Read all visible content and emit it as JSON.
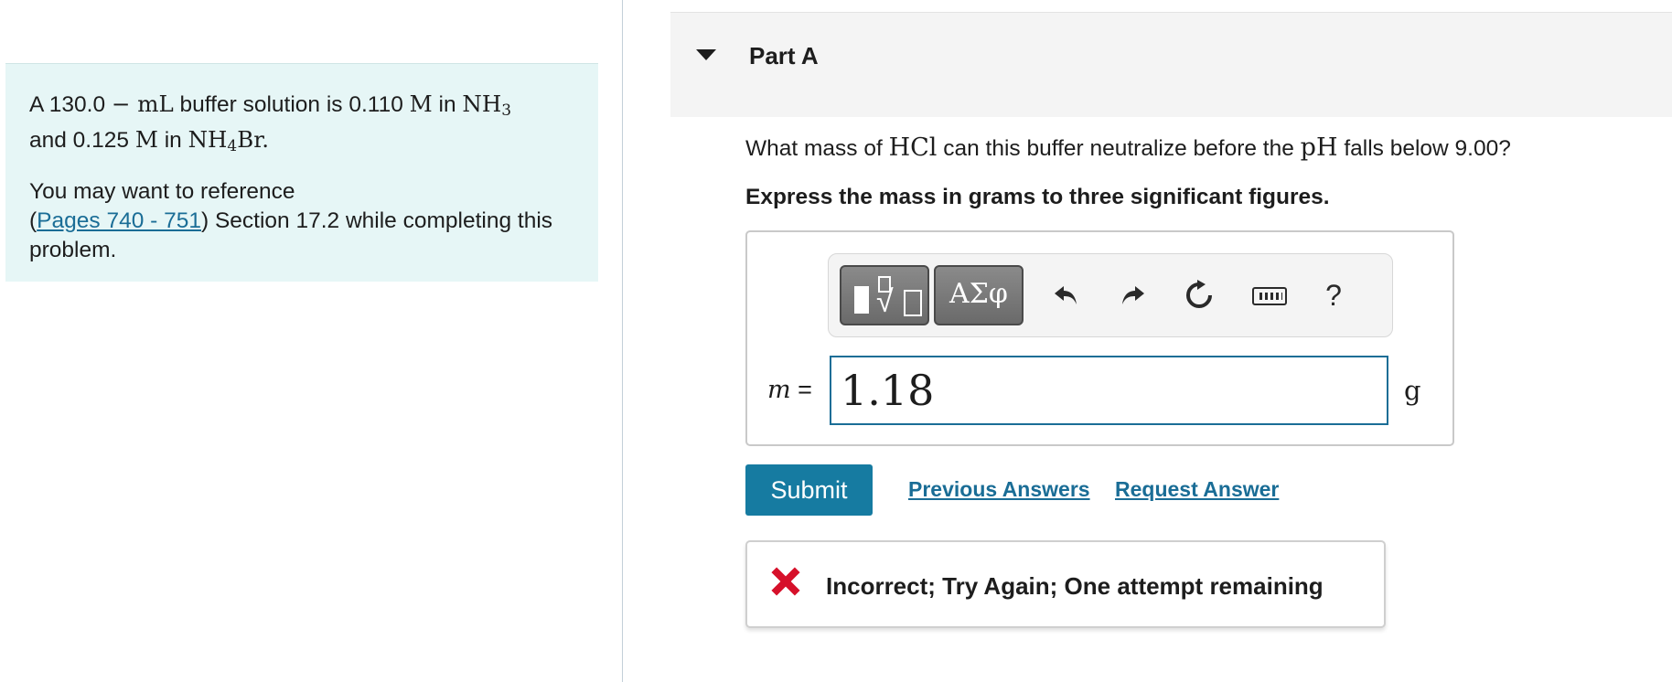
{
  "intro": {
    "p1": {
      "t1": "A 130.0 ",
      "m1": "− mL",
      "t2": " buffer solution is 0.110 ",
      "m2": "M",
      "t3": " in ",
      "m3_main": "NH",
      "m3_sub": "3",
      "t4": " and 0.125 ",
      "m4": "M",
      "t5": " in ",
      "m5_main": "NH",
      "m5_sub": "4",
      "m5_tail": "Br",
      "t6": "."
    },
    "ref_text_1": "You may want to reference",
    "ref_link": "Pages 740 - 751",
    "ref_text_2": ") Section 17.2 while completing this problem."
  },
  "part": {
    "title": "Part A"
  },
  "question": {
    "t1": "What mass of ",
    "m1": "HCl",
    "t2": " can this buffer neutralize before the ",
    "m2": "pH",
    "t3": " falls below 9.00?"
  },
  "instruction": "Express the mass in grams to three significant figures.",
  "toolbar": {
    "symbols_label": "ΑΣφ",
    "help_label": "?",
    "icons": [
      "templates-icon",
      "greek-symbols-icon",
      "undo-icon",
      "redo-icon",
      "reset-icon",
      "keyboard-icon",
      "help-icon"
    ]
  },
  "answer": {
    "variable": "m",
    "equals": " =",
    "value": "1.18",
    "unit": "g"
  },
  "actions": {
    "submit_label": "Submit",
    "previous_answers_label": "Previous Answers",
    "request_answer_label": "Request Answer"
  },
  "feedback": {
    "text": "Incorrect; Try Again; One attempt remaining",
    "status_color": "#d6102a"
  },
  "colors": {
    "accent": "#167ba1",
    "link": "#1a6d96",
    "intro_background": "#e6f6f6"
  }
}
